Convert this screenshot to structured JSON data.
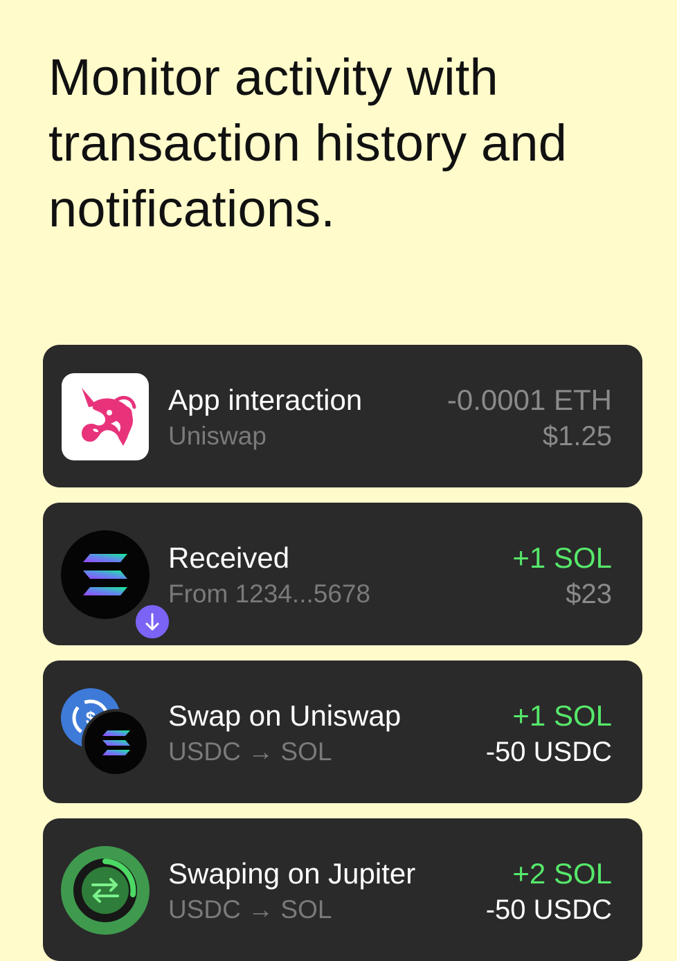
{
  "headline": "Monitor activity with transaction history and notifications.",
  "colors": {
    "background": "#FFFBCB",
    "card": "#2A2A2A",
    "positive": "#56E86A",
    "muted": "#7A7A7A"
  },
  "transactions": [
    {
      "icon": "uniswap-icon",
      "title": "App interaction",
      "subtitle": "Uniswap",
      "amount": "-0.0001 ETH",
      "sub_amount": "$1.25"
    },
    {
      "icon": "solana-icon",
      "badge": "arrow-down-icon",
      "title": "Received",
      "subtitle": "From 1234...5678",
      "amount": "+1 SOL",
      "sub_amount": "$23"
    },
    {
      "icon": "usdc-to-solana-icon",
      "title": "Swap on Uniswap",
      "subtitle": "USDC → SOL",
      "amount": "+1 SOL",
      "sub_amount": "-50 USDC"
    },
    {
      "icon": "swap-progress-icon",
      "title": "Swaping on Jupiter",
      "subtitle": "USDC → SOL",
      "amount": "+2 SOL",
      "sub_amount": "-50 USDC"
    }
  ]
}
